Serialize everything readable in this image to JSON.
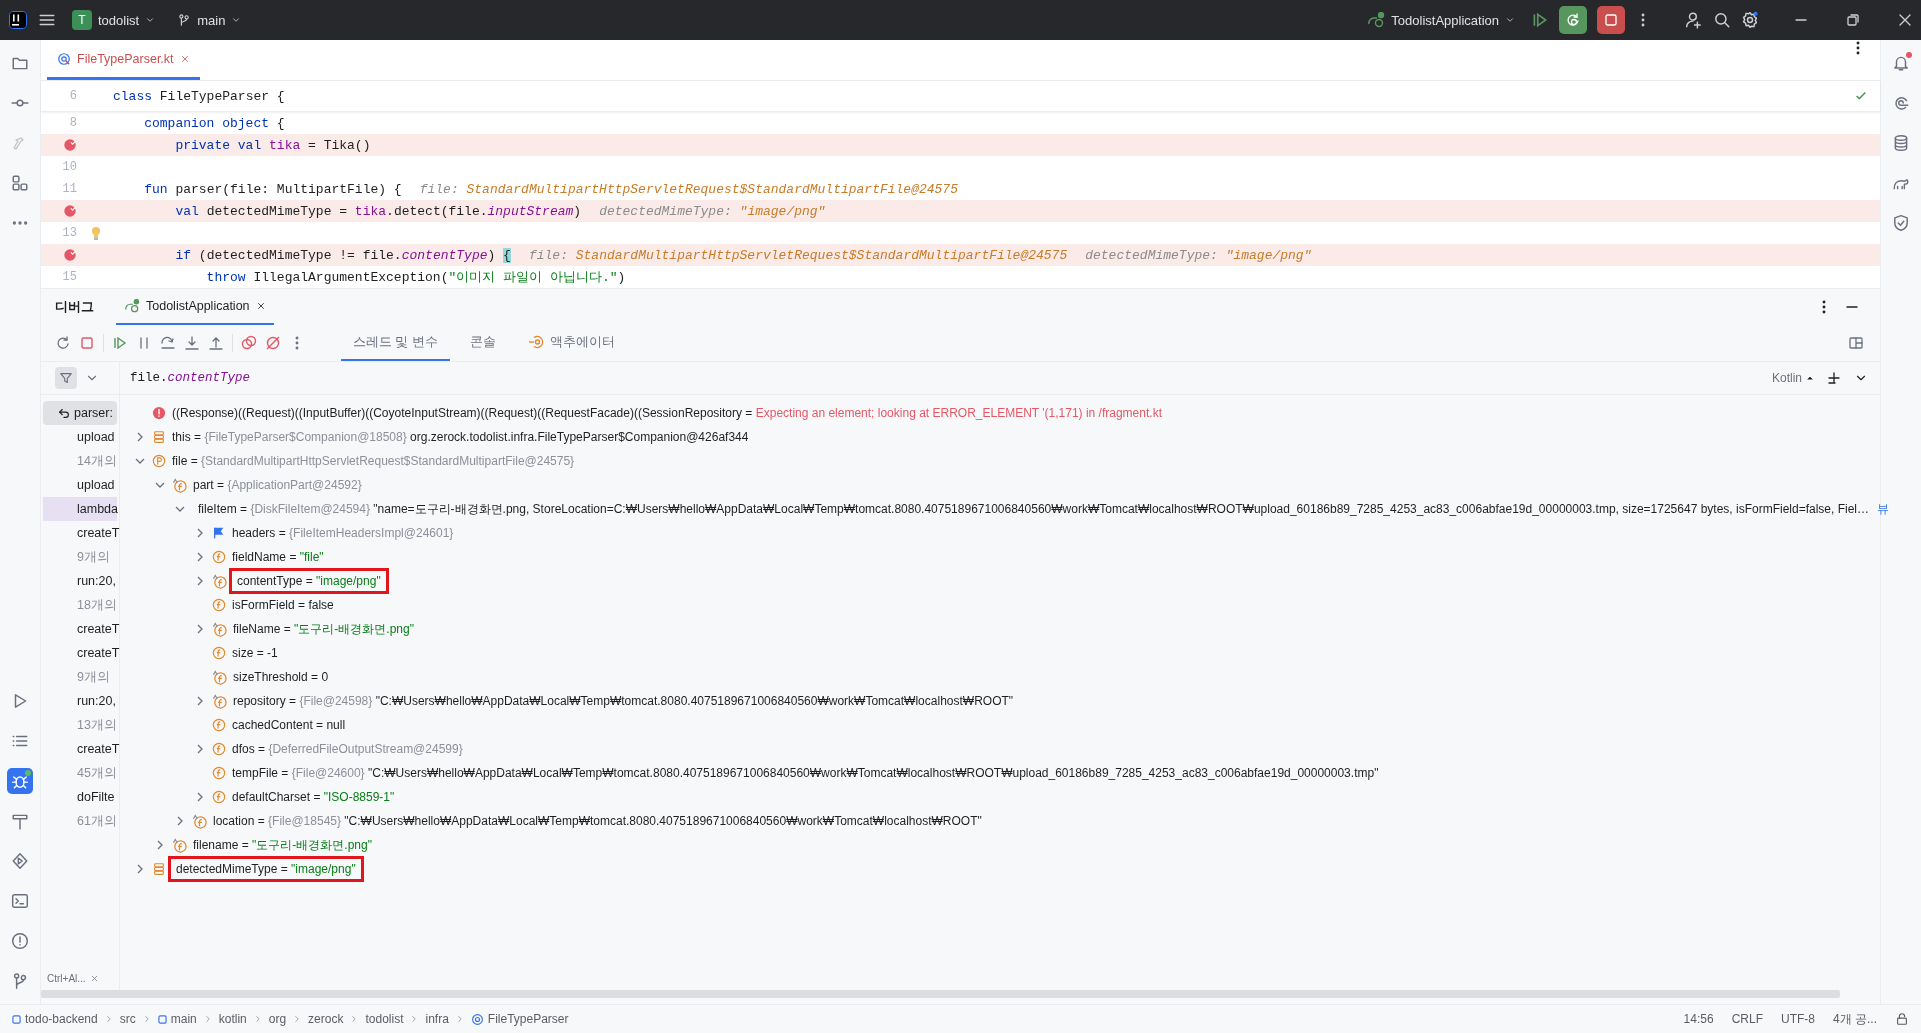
{
  "title_bar": {
    "project": {
      "badge": "T",
      "name": "todolist"
    },
    "branch": "main",
    "run_config": "TodolistApplication"
  },
  "editor": {
    "tabs": [
      {
        "label": "FileTypeParser.kt",
        "selected": true
      }
    ],
    "lines": [
      {
        "number": "6",
        "breakpoint": false,
        "highlighted": false,
        "bulb": false,
        "sticky": true,
        "segments": [
          {
            "kind": "kw",
            "text": "class "
          },
          {
            "kind": "plain",
            "text": "FileTypeParser {"
          }
        ]
      },
      {
        "number": "8",
        "breakpoint": false,
        "highlighted": false,
        "bulb": false,
        "sticky": false,
        "segments": [
          {
            "kind": "kw",
            "text": "    companion object "
          },
          {
            "kind": "plain",
            "text": "{"
          }
        ]
      },
      {
        "breakpoint": true,
        "highlighted": true,
        "bulb": false,
        "sticky": false,
        "segments": [
          {
            "kind": "kw",
            "text": "        private val "
          },
          {
            "kind": "prop",
            "text": "tika"
          },
          {
            "kind": "plain",
            "text": " = Tika()"
          }
        ]
      },
      {
        "number": "10",
        "breakpoint": false,
        "highlighted": false,
        "bulb": false,
        "sticky": false
      },
      {
        "number": "11",
        "breakpoint": false,
        "highlighted": false,
        "bulb": false,
        "sticky": false,
        "segments": [
          {
            "kind": "kw",
            "text": "    fun "
          },
          {
            "kind": "plain",
            "text": "parser(file: MultipartFile) {"
          },
          {
            "kind": "hint_label",
            "text": "file: "
          },
          {
            "kind": "hint_value",
            "text": "StandardMultipartHttpServletRequest$StandardMultipartFile@24575"
          }
        ]
      },
      {
        "breakpoint": true,
        "highlighted": true,
        "bulb": false,
        "sticky": false,
        "segments": [
          {
            "kind": "kw",
            "text": "        val "
          },
          {
            "kind": "plain",
            "text": "detectedMimeType = "
          },
          {
            "kind": "prop",
            "text": "tika"
          },
          {
            "kind": "plain",
            "text": ".detect(file."
          },
          {
            "kind": "prop_italic",
            "text": "inputStream"
          },
          {
            "kind": "plain",
            "text": ")"
          },
          {
            "kind": "hint_label",
            "text": "detectedMimeType: "
          },
          {
            "kind": "hint_value",
            "text": "\"image/png\""
          }
        ]
      },
      {
        "number": "13",
        "breakpoint": false,
        "highlighted": false,
        "bulb": true,
        "sticky": false
      },
      {
        "breakpoint": true,
        "highlighted": true,
        "bulb": false,
        "sticky": false,
        "segments": [
          {
            "kind": "kw",
            "text": "        if "
          },
          {
            "kind": "plain",
            "text": "(detectedMimeType != file."
          },
          {
            "kind": "prop_italic",
            "text": "contentType"
          },
          {
            "kind": "plain",
            "text": ") "
          },
          {
            "kind": "brace_match",
            "text": "{"
          },
          {
            "kind": "hint_label",
            "text": "file: "
          },
          {
            "kind": "hint_value",
            "text": "StandardMultipartHttpServletRequest$StandardMultipartFile@24575"
          },
          {
            "kind": "hint_label",
            "text": "detectedMimeType: "
          },
          {
            "kind": "hint_value",
            "text": "\"image/png\""
          }
        ]
      },
      {
        "number": "15",
        "breakpoint": false,
        "highlighted": false,
        "bulb": false,
        "sticky": false,
        "segments": [
          {
            "kind": "kw",
            "text": "            throw "
          },
          {
            "kind": "plain",
            "text": "IllegalArgumentException("
          },
          {
            "kind": "str",
            "text": "\"이미지 파일이 아닙니다.\""
          },
          {
            "kind": "plain",
            "text": ")"
          }
        ]
      }
    ]
  },
  "debug": {
    "title": "디버그",
    "session_tab": {
      "label": "TodolistApplication",
      "selected": true
    },
    "tabs": [
      {
        "label": "스레드 및 변수",
        "selected": true
      },
      {
        "label": "콘솔",
        "selected": false
      },
      {
        "label": "액추에이터",
        "selected": false
      }
    ],
    "expression": {
      "object": "file.",
      "member": "contentType"
    },
    "language": "Kotlin",
    "frames_hint": "Ctrl+Al...",
    "frames": [
      {
        "text": "parser:",
        "kind": "current",
        "selected": false
      },
      {
        "text": "upload",
        "kind": "frame",
        "selected": false
      },
      {
        "text": "14개의",
        "kind": "group",
        "selected": false
      },
      {
        "text": "upload",
        "kind": "frame",
        "selected": false
      },
      {
        "text": "lambda",
        "kind": "frame",
        "selected": true
      },
      {
        "text": "createT",
        "kind": "frame",
        "selected": false
      },
      {
        "text": "9개의",
        "kind": "group",
        "selected": false
      },
      {
        "text": "run:20,",
        "kind": "frame",
        "selected": false
      },
      {
        "text": "18개의",
        "kind": "group",
        "selected": false
      },
      {
        "text": "createT",
        "kind": "frame",
        "selected": false
      },
      {
        "text": "createT",
        "kind": "frame",
        "selected": false
      },
      {
        "text": "9개의",
        "kind": "group",
        "selected": false
      },
      {
        "text": "run:20,",
        "kind": "frame",
        "selected": false
      },
      {
        "text": "13개의",
        "kind": "group",
        "selected": false
      },
      {
        "text": "createT",
        "kind": "frame",
        "selected": false
      },
      {
        "text": "45개의",
        "kind": "group",
        "selected": false
      },
      {
        "text": "doFilte",
        "kind": "frame",
        "selected": false
      },
      {
        "text": "61개의",
        "kind": "group",
        "selected": false
      }
    ],
    "variables": [
      {
        "kind": "error",
        "name": "((Response)((Request)((InputBuffer)((CoyoteInputStream)((Request)((RequestFacade)((SessionRepository",
        "eq": "=",
        "value": "Expecting an element; looking at ERROR_ELEMENT '(1,171) in /fragment.kt",
        "boxed": false
      },
      {
        "kind": "static",
        "name": "this",
        "eq": "=",
        "ref": "{FileTypeParser$Companion@18508}",
        "value": "org.zerock.todolist.infra.FileTypeParser$Companion@426af344",
        "string": false,
        "expanded": false,
        "boxed": false
      },
      {
        "kind": "param",
        "name": "file",
        "eq": "=",
        "ref": "{StandardMultipartHttpServletRequest$StandardMultipartFile@24575}",
        "expanded": true,
        "boxed": false,
        "children": [
          {
            "kind": "field_final",
            "name": "part",
            "eq": "=",
            "ref": "{ApplicationPart@24592}",
            "expanded": true,
            "boxed": false,
            "children": [
              {
                "kind": "field_final",
                "name": "fileItem",
                "eq": "=",
                "ref": "{DiskFileItem@24594}",
                "value": "\"name=도구리-배경화면.png, StoreLocation=C:₩Users₩hello₩AppData₩Local₩Temp₩tomcat.8080.4075189671006840560₩work₩Tomcat₩localhost₩ROOT₩upload_60186b89_7285_4253_ac83_c006abfae19d_00000003.tmp, size=1725647 bytes, isFormField=false, Fiel…",
                "string": false,
                "link": "뷰",
                "expanded": true,
                "boxed": false,
                "children": [
                  {
                    "kind": "flag",
                    "name": "headers",
                    "eq": "=",
                    "ref": "{FileItemHeadersImpl@24601}",
                    "expanded": false,
                    "boxed": false
                  },
                  {
                    "kind": "field",
                    "name": "fieldName",
                    "eq": "=",
                    "value": "\"file\"",
                    "string": true,
                    "expanded": false,
                    "boxed": false
                  },
                  {
                    "kind": "field_final",
                    "name": "contentType",
                    "eq": "=",
                    "value": "\"image/png\"",
                    "string": true,
                    "expanded": false,
                    "boxed": true
                  },
                  {
                    "kind": "field",
                    "name": "isFormField",
                    "eq": "=",
                    "value": "false",
                    "string": false,
                    "boxed": false
                  },
                  {
                    "kind": "field_final",
                    "name": "fileName",
                    "eq": "=",
                    "value": "\"도구리-배경화면.png\"",
                    "string": true,
                    "expanded": false,
                    "boxed": false
                  },
                  {
                    "kind": "field",
                    "name": "size",
                    "eq": "=",
                    "value": "-1",
                    "string": false,
                    "boxed": false
                  },
                  {
                    "kind": "field_final",
                    "name": "sizeThreshold",
                    "eq": "=",
                    "value": "0",
                    "string": false,
                    "boxed": false
                  },
                  {
                    "kind": "field_final",
                    "name": "repository",
                    "eq": "=",
                    "ref": "{File@24598}",
                    "value": "\"C:₩Users₩hello₩AppData₩Local₩Temp₩tomcat.8080.4075189671006840560₩work₩Tomcat₩localhost₩ROOT\"",
                    "string": false,
                    "expanded": false,
                    "boxed": false
                  },
                  {
                    "kind": "field",
                    "name": "cachedContent",
                    "eq": "=",
                    "value": "null",
                    "string": false,
                    "boxed": false
                  },
                  {
                    "kind": "field",
                    "name": "dfos",
                    "eq": "=",
                    "ref": "{DeferredFileOutputStream@24599}",
                    "expanded": false,
                    "boxed": false
                  },
                  {
                    "kind": "field",
                    "name": "tempFile",
                    "eq": "=",
                    "ref": "{File@24600}",
                    "value": "\"C:₩Users₩hello₩AppData₩Local₩Temp₩tomcat.8080.4075189671006840560₩work₩Tomcat₩localhost₩ROOT₩upload_60186b89_7285_4253_ac83_c006abfae19d_00000003.tmp\"",
                    "string": false,
                    "boxed": false
                  },
                  {
                    "kind": "field",
                    "name": "defaultCharset",
                    "eq": "=",
                    "value": "\"ISO-8859-1\"",
                    "string": true,
                    "expanded": false,
                    "boxed": false
                  }
                ]
              },
              {
                "kind": "field_final",
                "name": "location",
                "eq": "=",
                "ref": "{File@18545}",
                "value": "\"C:₩Users₩hello₩AppData₩Local₩Temp₩tomcat.8080.4075189671006840560₩work₩Tomcat₩localhost₩ROOT\"",
                "string": false,
                "expanded": false,
                "boxed": false
              }
            ]
          },
          {
            "kind": "field_final",
            "name": "filename",
            "eq": "=",
            "value": "\"도구리-배경화면.png\"",
            "string": true,
            "expanded": false,
            "boxed": false
          }
        ]
      },
      {
        "kind": "static",
        "name": "detectedMimeType",
        "eq": "=",
        "value": "\"image/png\"",
        "string": true,
        "expanded": false,
        "boxed": true
      }
    ]
  },
  "status_bar": {
    "breadcrumbs": [
      {
        "text": "todo-backend",
        "kind": "module"
      },
      {
        "text": "src",
        "kind": "plain"
      },
      {
        "text": "main",
        "kind": "module"
      },
      {
        "text": "kotlin",
        "kind": "plain"
      },
      {
        "text": "org",
        "kind": "plain"
      },
      {
        "text": "zerock",
        "kind": "plain"
      },
      {
        "text": "todolist",
        "kind": "plain"
      },
      {
        "text": "infra",
        "kind": "plain"
      },
      {
        "text": "FileTypeParser",
        "kind": "class"
      }
    ],
    "items": [
      "14:56",
      "CRLF",
      "UTF-8",
      "4개 공..."
    ]
  }
}
